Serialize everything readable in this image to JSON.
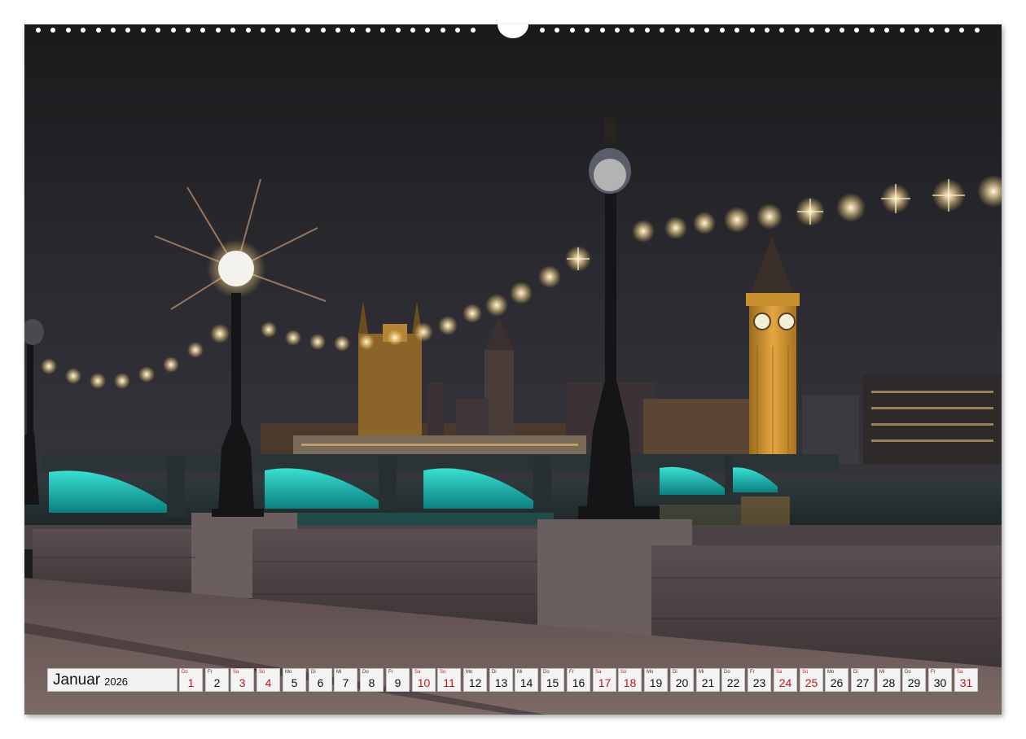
{
  "calendar": {
    "month": "Januar",
    "year": "2026",
    "weekend_color": "#c0161d",
    "days": [
      {
        "wd": "Do",
        "n": "1",
        "weekend": true
      },
      {
        "wd": "Fr",
        "n": "2",
        "weekend": false
      },
      {
        "wd": "Sa",
        "n": "3",
        "weekend": true
      },
      {
        "wd": "So",
        "n": "4",
        "weekend": true
      },
      {
        "wd": "Mo",
        "n": "5",
        "weekend": false
      },
      {
        "wd": "Di",
        "n": "6",
        "weekend": false
      },
      {
        "wd": "Mi",
        "n": "7",
        "weekend": false
      },
      {
        "wd": "Do",
        "n": "8",
        "weekend": false
      },
      {
        "wd": "Fr",
        "n": "9",
        "weekend": false
      },
      {
        "wd": "Sa",
        "n": "10",
        "weekend": true
      },
      {
        "wd": "So",
        "n": "11",
        "weekend": true
      },
      {
        "wd": "Mo",
        "n": "12",
        "weekend": false
      },
      {
        "wd": "Di",
        "n": "13",
        "weekend": false
      },
      {
        "wd": "Mi",
        "n": "14",
        "weekend": false
      },
      {
        "wd": "Do",
        "n": "15",
        "weekend": false
      },
      {
        "wd": "Fr",
        "n": "16",
        "weekend": false
      },
      {
        "wd": "Sa",
        "n": "17",
        "weekend": true
      },
      {
        "wd": "So",
        "n": "18",
        "weekend": true
      },
      {
        "wd": "Mo",
        "n": "19",
        "weekend": false
      },
      {
        "wd": "Di",
        "n": "20",
        "weekend": false
      },
      {
        "wd": "Mi",
        "n": "21",
        "weekend": false
      },
      {
        "wd": "Do",
        "n": "22",
        "weekend": false
      },
      {
        "wd": "Fr",
        "n": "23",
        "weekend": false
      },
      {
        "wd": "Sa",
        "n": "24",
        "weekend": true
      },
      {
        "wd": "So",
        "n": "25",
        "weekend": true
      },
      {
        "wd": "Mo",
        "n": "26",
        "weekend": false
      },
      {
        "wd": "Di",
        "n": "27",
        "weekend": false
      },
      {
        "wd": "Mi",
        "n": "28",
        "weekend": false
      },
      {
        "wd": "Do",
        "n": "29",
        "weekend": false
      },
      {
        "wd": "Fr",
        "n": "30",
        "weekend": false
      },
      {
        "wd": "Sa",
        "n": "31",
        "weekend": true
      }
    ]
  }
}
